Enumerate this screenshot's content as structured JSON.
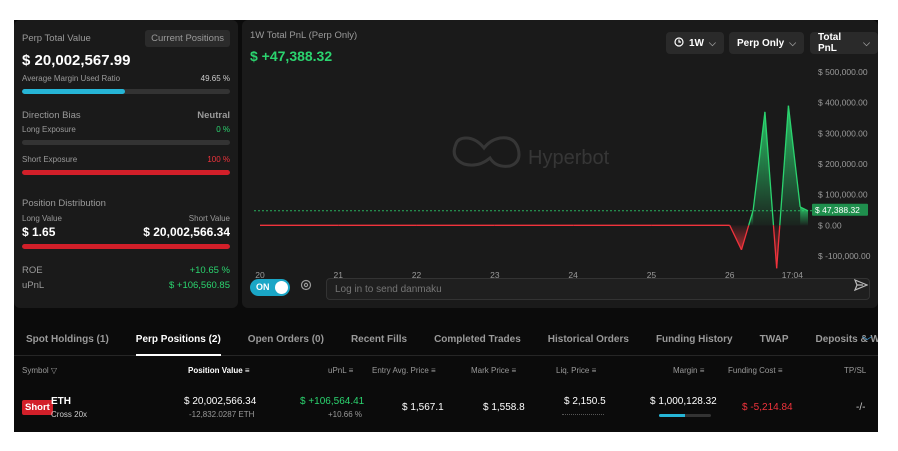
{
  "summary": {
    "perp_total_value_label": "Perp Total Value",
    "current_positions_btn": "Current Positions",
    "perp_total_value": "$ 20,002,567.99",
    "avg_margin_label": "Average Margin Used Ratio",
    "avg_margin_value": "49.65 %",
    "avg_margin_ratio": 0.4965,
    "direction_bias_label": "Direction Bias",
    "direction_bias_value": "Neutral",
    "long_exposure_label": "Long Exposure",
    "long_exposure_value": "0 %",
    "long_exposure_ratio": 0,
    "short_exposure_label": "Short Exposure",
    "short_exposure_value": "100 %",
    "short_exposure_ratio": 1,
    "position_distribution_label": "Position Distribution",
    "long_value_label": "Long Value",
    "short_value_label": "Short Value",
    "long_value": "$ 1.65",
    "short_value": "$ 20,002,566.34",
    "short_value_ratio": 1,
    "roe_label": "ROE",
    "roe_value": "+10.65 %",
    "upnl_label": "uPnL",
    "upnl_value": "$ +106,560.85"
  },
  "chart": {
    "title": "1W Total PnL (Perp Only)",
    "pnl_value": "$ +47,388.32",
    "period_select": "1W",
    "scope_select": "Perp Only",
    "metric_select": "Total PnL",
    "watermark": "Hyperbot",
    "current_value_label": "$ 47,388.32",
    "danmaku_toggle": "ON",
    "danmaku_placeholder": "Log in to send danmaku"
  },
  "chart_data": {
    "type": "line",
    "x": [
      20,
      21,
      22,
      23,
      24,
      25,
      26,
      26.15,
      26.3,
      26.45,
      26.6,
      26.75,
      26.9,
      27
    ],
    "x_tick_labels": [
      "20",
      "21",
      "22",
      "23",
      "24",
      "25",
      "26",
      "17:04"
    ],
    "y_tick_labels": [
      "$ 500,000.00",
      "$ 400,000.00",
      "$ 300,000.00",
      "$ 200,000.00",
      "$ 100,000.00",
      "$ 0.00",
      "$ -100,000.00"
    ],
    "ylim": [
      -100000,
      500000
    ],
    "series": [
      {
        "values": [
          0,
          0,
          0,
          0,
          0,
          0,
          0,
          -80000,
          50000,
          370000,
          -140000,
          390000,
          60000,
          47388
        ]
      }
    ],
    "reference_line": 47388.32,
    "colors": {
      "positive": "#2bd46f",
      "negative": "#f0333c"
    }
  },
  "tabs": [
    "Spot Holdings (1)",
    "Perp Positions (2)",
    "Open Orders (0)",
    "Recent Fills",
    "Completed Trades",
    "Historical Orders",
    "Funding History",
    "TWAP",
    "Deposits & Withdrav"
  ],
  "table": {
    "headers": {
      "symbol": "Symbol",
      "position_value": "Position Value",
      "upnl": "uPnL",
      "entry": "Entry Avg. Price",
      "mark": "Mark Price",
      "liq": "Liq. Price",
      "margin": "Margin",
      "funding": "Funding Cost",
      "tpsl": "TP/SL"
    },
    "row": {
      "side": "Short",
      "coin": "ETH",
      "leverage": "Cross 20x",
      "position_value": "$ 20,002,566.34",
      "position_size": "-12,832.0287 ETH",
      "upnl": "$ +106,564.41",
      "upnl_pct": "+10.66 %",
      "entry": "$ 1,567.1",
      "mark": "$ 1,558.8",
      "liq": "$ 2,150.5",
      "margin": "$ 1,000,128.32",
      "margin_ratio": 0.5,
      "funding": "$ -5,214.84",
      "tpsl": "-/-"
    }
  }
}
